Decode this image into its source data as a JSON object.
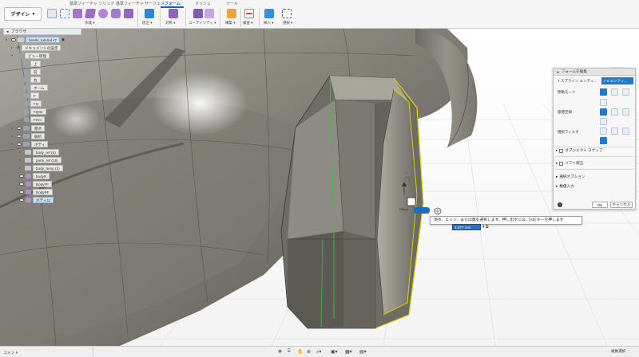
{
  "workspace": {
    "label": "デザイン"
  },
  "tabs": [
    {
      "label": "基準フィーチャ ソリッド"
    },
    {
      "label": "基準フィーチャ サーフェス"
    },
    {
      "label": "フォーム"
    },
    {
      "label": "メッシュ"
    },
    {
      "label": "ツール"
    }
  ],
  "groups": {
    "create": "作成",
    "modify": "修正",
    "symmetry": "対称",
    "utility": "ユーティリティ",
    "construct": "構築",
    "inspect": "検査",
    "select": "選択"
  },
  "browser": {
    "title": "ブラウザ",
    "items": [
      {
        "label": "beetle_tutorial v7"
      },
      {
        "label": "ドキュメントの設定"
      },
      {
        "label": "ビュー管理"
      },
      {
        "label": "上"
      },
      {
        "label": "前"
      },
      {
        "label": "右"
      },
      {
        "label": "ホーム"
      },
      {
        "label": "F"
      },
      {
        "label": "FQ"
      },
      {
        "label": "FQ02"
      },
      {
        "label": "FHm"
      },
      {
        "label": "原点"
      },
      {
        "label": "解析"
      },
      {
        "label": "ボディ"
      },
      {
        "label": "body_ref (6)"
      },
      {
        "label": "parts_ref (18)"
      },
      {
        "label": "body_temp (1)"
      },
      {
        "label": "bodyR"
      },
      {
        "label": "BodyFF"
      },
      {
        "label": "BodyRF"
      },
      {
        "label": "ボディ11"
      }
    ]
  },
  "viewcube": {
    "face": "前"
  },
  "panel": {
    "title": "フォームを編集",
    "selector_label": "T スプライン エンティ...",
    "selector_value": "8 エンティ...",
    "rows": {
      "move_mode": "移動モード",
      "coord_space": "座標空間",
      "select_filter": "選択フィルタ"
    },
    "sections": {
      "object_snap": "オブジェクト スナップ",
      "soft_modify": "ソフト修正",
      "select_options": "選択オプション",
      "numeric_input": "数値入力"
    },
    "ok": "OK",
    "cancel": "キャンセル"
  },
  "tooltip": "頂点、エッジ、または面を選択します。押し出すには、[Alt] キーを押します",
  "distance_input": "2.577 mm",
  "manip_label": "Offset",
  "bottom": {
    "comment": "コメント",
    "selection_mode": "複数選択"
  },
  "colors": {
    "accent": "#0a66c2",
    "selected_edge": "#e6d800",
    "seam_edge": "#3cbf3c",
    "surface": "#8c8a80"
  },
  "icons": {
    "toolbar": [
      "create-box-icon",
      "create-form-icon",
      "edit-form-icon",
      "symmetry-icon",
      "utility-icon",
      "construct-plane-icon",
      "measure-icon",
      "inspect-icon",
      "select-icon"
    ],
    "bottom": [
      "orbit-icon",
      "pan-icon",
      "zoom-icon",
      "fit-icon",
      "display-settings-icon",
      "grid-icon",
      "view-settings-icon"
    ]
  }
}
